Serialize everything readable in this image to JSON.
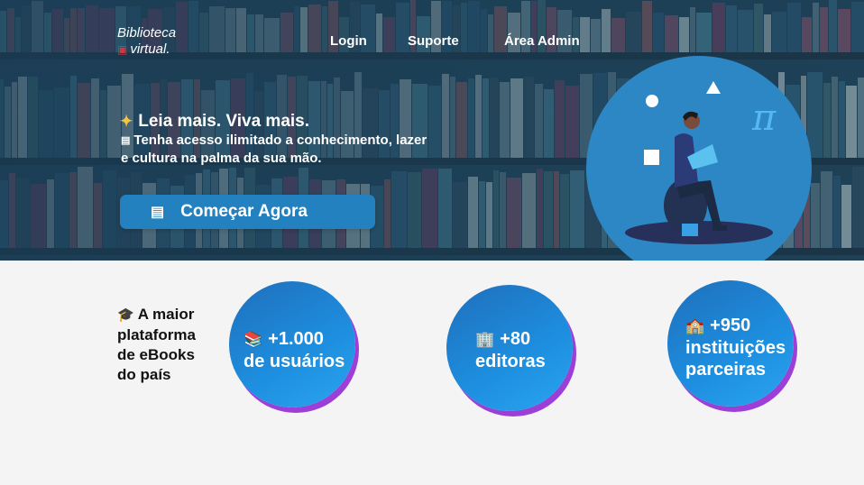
{
  "brand": {
    "line1": "Biblioteca",
    "line2": "virtual."
  },
  "nav": {
    "login": "Login",
    "support": "Suporte",
    "admin": "Área Admin"
  },
  "hero": {
    "tagline": "Leia mais. Viva mais.",
    "subtitle": "Tenha acesso ilimitado a conhecimento, lazer e cultura na palma da sua mão.",
    "cta_label": "Começar Agora"
  },
  "illustration": {
    "pi_symbol": "π"
  },
  "stats": {
    "title": "A maior plataforma de eBooks do país",
    "items": [
      {
        "value": "+1.000",
        "label": "de usuários",
        "icon": "books-icon"
      },
      {
        "value": "+80",
        "label": "editoras",
        "icon": "office-building-icon"
      },
      {
        "value": "+950",
        "label": "instituições parceiras",
        "icon": "school-icon"
      }
    ]
  },
  "colors": {
    "hero_overlay": "#1f4257",
    "cta": "#2381bf",
    "illustration_circle": "#2e87c5",
    "stat_circle": "#1e8fe0",
    "stat_shadow": "#9b3fd6",
    "page_bg": "#f4f4f5"
  }
}
